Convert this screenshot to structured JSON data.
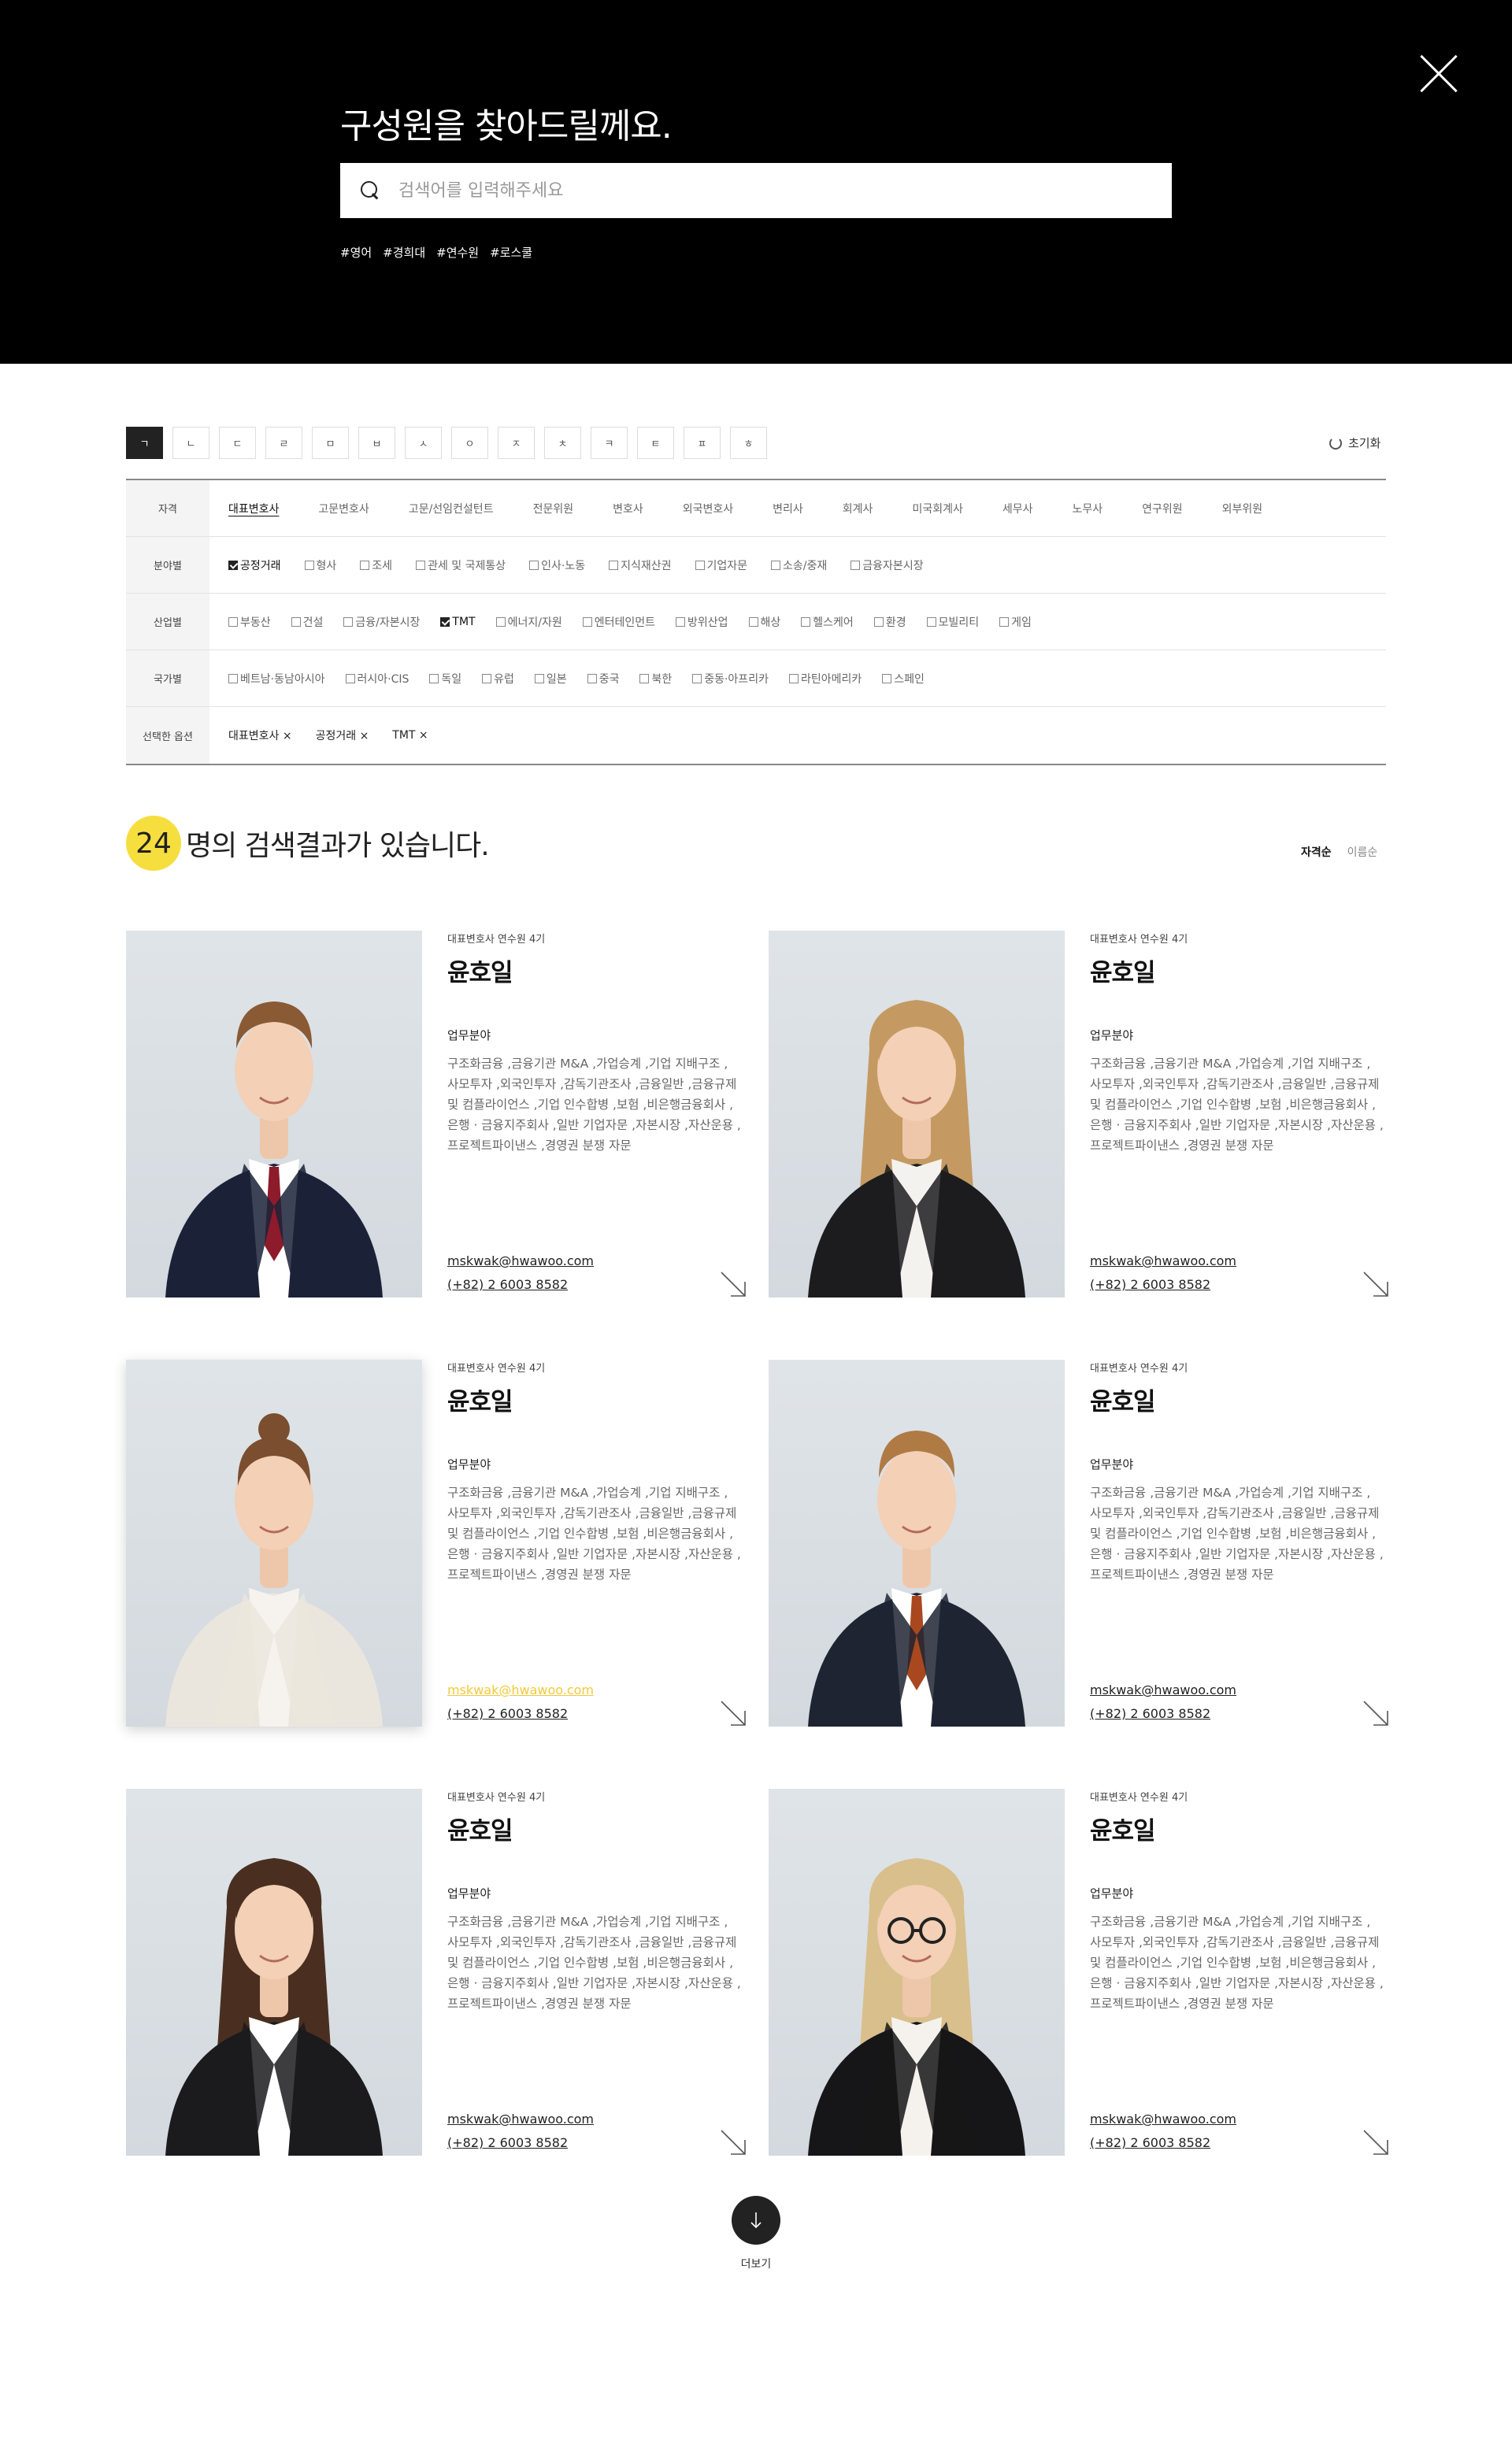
{
  "header": {
    "title": "구성원을 찾아드릴께요.",
    "search_placeholder": "검색어를 입력해주세요",
    "tags": [
      "#영어",
      "#경희대",
      "#연수원",
      "#로스쿨"
    ]
  },
  "consonants": {
    "items": [
      "ㄱ",
      "ㄴ",
      "ㄷ",
      "ㄹ",
      "ㅁ",
      "ㅂ",
      "ㅅ",
      "ㅇ",
      "ㅈ",
      "ㅊ",
      "ㅋ",
      "ㅌ",
      "ㅍ",
      "ㅎ"
    ],
    "active_index": 0,
    "reset_label": "초기화"
  },
  "filters": {
    "qualification": {
      "label": "자격",
      "items": [
        "대표변호사",
        "고문변호사",
        "고문/선임컨설턴트",
        "전문위원",
        "변호사",
        "외국변호사",
        "변리사",
        "회계사",
        "미국회계사",
        "세무사",
        "노무사",
        "연구위원",
        "외부위원"
      ],
      "active_index": 0
    },
    "practice": {
      "label": "분야별",
      "items": [
        "공정거래",
        "형사",
        "조세",
        "관세 및 국제통상",
        "인사·노동",
        "지식재산권",
        "기업자문",
        "소송/중재",
        "금융자본시장"
      ],
      "checked": [
        0
      ]
    },
    "industry": {
      "label": "산업별",
      "items": [
        "부동산",
        "건설",
        "금융/자본시장",
        "TMT",
        "에너지/자원",
        "엔터테인먼트",
        "방위산업",
        "해상",
        "헬스케어",
        "환경",
        "모빌리티",
        "게임"
      ],
      "checked": [
        3
      ]
    },
    "country": {
      "label": "국가별",
      "items": [
        "베트남·동남아시아",
        "러시아·CIS",
        "독일",
        "유럽",
        "일본",
        "중국",
        "북한",
        "중동·아프리카",
        "라틴아메리카",
        "스페인"
      ],
      "checked": []
    },
    "selected": {
      "label": "선택한 옵션",
      "items": [
        "대표변호사 ×",
        "공정거래 ×",
        "TMT ×"
      ]
    }
  },
  "results": {
    "count": "24",
    "text": "명의 검색결과가 있습니다.",
    "sort": [
      "자격순",
      "이름순"
    ],
    "sort_active": 0
  },
  "members": [
    {
      "sub": "대표변호사 연수원 4기",
      "name": "윤호일",
      "field_label": "업무분야",
      "desc": "구조화금융 ,금융기관 M&A ,가업승계 ,기업 지배구조 ,사모투자 ,외국인투자 ,감독기관조사 ,금융일반 ,금융규제 및 컴플라이언스 ,기업 인수합병 ,보험 ,비은행금융회사 ,은행 · 금융지주회사 ,일반 기업자문 ,자본시장 ,자산운용 ,프로젝트파이낸스 ,경영권 분쟁 자문",
      "email": "mskwak@hwawoo.com",
      "phone": "(+82) 2 6003 8582",
      "suit": "#1b2238",
      "shirt": "#ffffff",
      "tie": "#8e1b2c",
      "hair": "#8a5a34",
      "hair_style": "short",
      "email_highlight": false,
      "shadow": false
    },
    {
      "sub": "대표변호사 연수원 4기",
      "name": "윤호일",
      "field_label": "업무분야",
      "desc": "구조화금융 ,금융기관 M&A ,가업승계 ,기업 지배구조 ,사모투자 ,외국인투자 ,감독기관조사 ,금융일반 ,금융규제 및 컴플라이언스 ,기업 인수합병 ,보험 ,비은행금융회사 ,은행 · 금융지주회사 ,일반 기업자문 ,자본시장 ,자산운용 ,프로젝트파이낸스 ,경영권 분쟁 자문",
      "email": "mskwak@hwawoo.com",
      "phone": "(+82) 2 6003 8582",
      "suit": "#1c1c1f",
      "shirt": "#f4f2ef",
      "tie": "",
      "hair": "#c49a62",
      "hair_style": "long",
      "email_highlight": false,
      "shadow": false
    },
    {
      "sub": "대표변호사 연수원 4기",
      "name": "윤호일",
      "field_label": "업무분야",
      "desc": "구조화금융 ,금융기관 M&A ,가업승계 ,기업 지배구조 ,사모투자 ,외국인투자 ,감독기관조사 ,금융일반 ,금융규제 및 컴플라이언스 ,기업 인수합병 ,보험 ,비은행금융회사 ,은행 · 금융지주회사 ,일반 기업자문 ,자본시장 ,자산운용 ,프로젝트파이낸스 ,경영권 분쟁 자문",
      "email": "mskwak@hwawoo.com",
      "phone": "(+82) 2 6003 8582",
      "suit": "#ebe6dd",
      "shirt": "#f6f3ee",
      "tie": "",
      "hair": "#7a4e2e",
      "hair_style": "bun",
      "email_highlight": true,
      "shadow": true
    },
    {
      "sub": "대표변호사 연수원 4기",
      "name": "윤호일",
      "field_label": "업무분야",
      "desc": "구조화금융 ,금융기관 M&A ,가업승계 ,기업 지배구조 ,사모투자 ,외국인투자 ,감독기관조사 ,금융일반 ,금융규제 및 컴플라이언스 ,기업 인수합병 ,보험 ,비은행금융회사 ,은행 · 금융지주회사 ,일반 기업자문 ,자본시장 ,자산운용 ,프로젝트파이낸스 ,경영권 분쟁 자문",
      "email": "mskwak@hwawoo.com",
      "phone": "(+82) 2 6003 8582",
      "suit": "#1f2433",
      "shirt": "#ffffff",
      "tie": "#a9481f",
      "hair": "#b07a44",
      "hair_style": "short",
      "email_highlight": false,
      "shadow": false
    },
    {
      "sub": "대표변호사 연수원 4기",
      "name": "윤호일",
      "field_label": "업무분야",
      "desc": "구조화금융 ,금융기관 M&A ,가업승계 ,기업 지배구조 ,사모투자 ,외국인투자 ,감독기관조사 ,금융일반 ,금융규제 및 컴플라이언스 ,기업 인수합병 ,보험 ,비은행금융회사 ,은행 · 금융지주회사 ,일반 기업자문 ,자본시장 ,자산운용 ,프로젝트파이낸스 ,경영권 분쟁 자문",
      "email": "mskwak@hwawoo.com",
      "phone": "(+82) 2 6003 8582",
      "suit": "#1b1b1d",
      "shirt": "#ffffff",
      "tie": "",
      "hair": "#4a2f20",
      "hair_style": "long",
      "email_highlight": false,
      "shadow": false
    },
    {
      "sub": "대표변호사 연수원 4기",
      "name": "윤호일",
      "field_label": "업무분야",
      "desc": "구조화금융 ,금융기관 M&A ,가업승계 ,기업 지배구조 ,사모투자 ,외국인투자 ,감독기관조사 ,금융일반 ,금융규제 및 컴플라이언스 ,기업 인수합병 ,보험 ,비은행금융회사 ,은행 · 금융지주회사 ,일반 기업자문 ,자본시장 ,자산운용 ,프로젝트파이낸스 ,경영권 분쟁 자문",
      "email": "mskwak@hwawoo.com",
      "phone": "(+82) 2 6003 8582",
      "suit": "#161618",
      "shirt": "#f5f2ee",
      "tie": "",
      "hair": "#d9bf8c",
      "hair_style": "long",
      "glasses": true,
      "email_highlight": false,
      "shadow": false
    }
  ],
  "more_label": "더보기"
}
